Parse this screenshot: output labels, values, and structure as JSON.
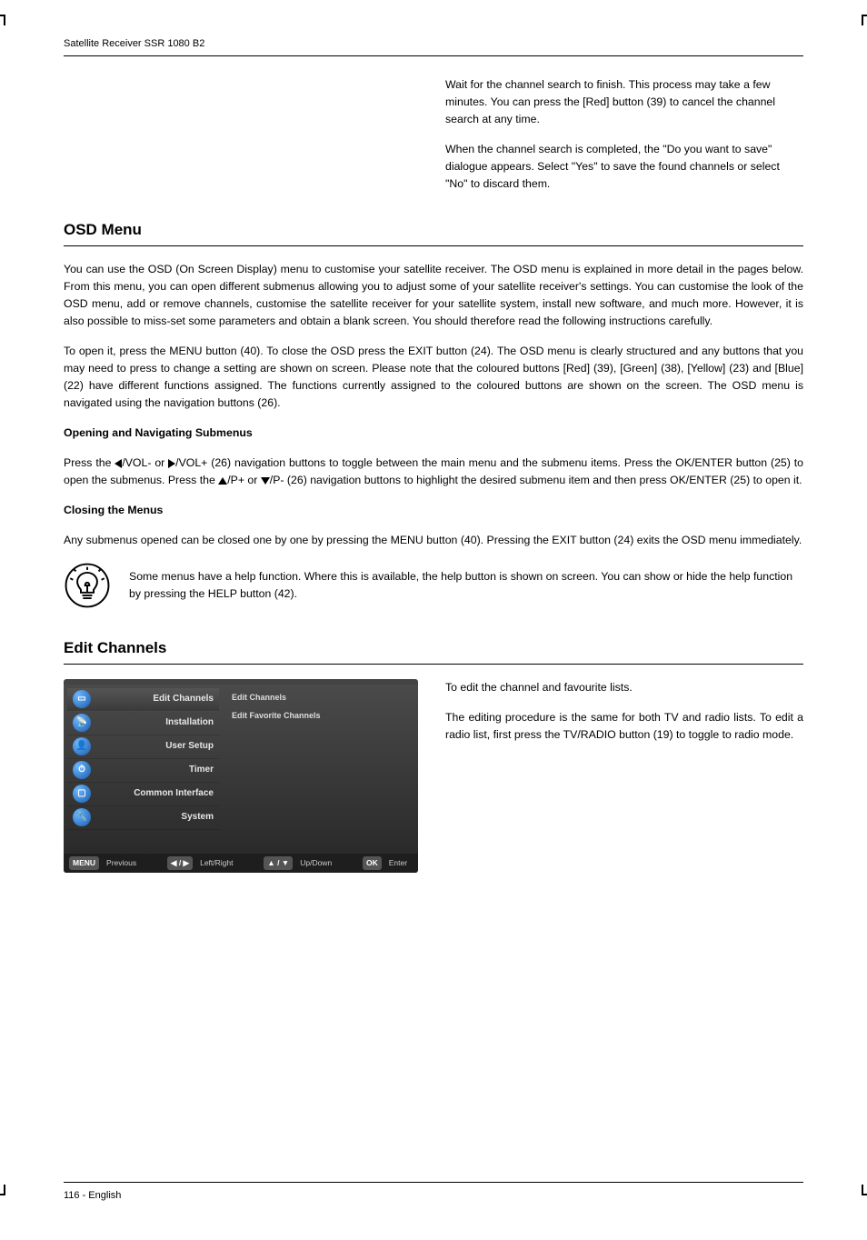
{
  "header": {
    "product": "Satellite Receiver SSR 1080 B2"
  },
  "intro_right": {
    "p1": "Wait for the channel search to finish. This process may take a few minutes. You can press the [Red] button (39) to cancel the channel search at any time.",
    "p2": "When the channel search is completed, the \"Do you want to save\" dialogue appears. Select \"Yes\" to save the found channels or select \"No\" to discard them."
  },
  "osd_menu": {
    "title": "OSD Menu",
    "p1": "You can use the OSD (On Screen Display) menu to customise your satellite receiver. The OSD menu is explained in more detail in the pages below. From this menu, you can open different submenus allowing you to adjust some of your satellite receiver's settings. You can customise the look of the OSD menu, add or remove channels, customise the satellite receiver for your satellite system, install new software, and much more. However, it is also possible to miss-set some parameters and obtain a blank screen. You should therefore read the following instructions carefully.",
    "p2": "To open it, press the MENU button (40). To close the OSD press the EXIT button (24). The OSD menu is clearly structured and any buttons that you may need to press to change a setting are shown on screen. Please note that the coloured buttons [Red] (39), [Green] (38), [Yellow] (23) and [Blue] (22) have different functions assigned. The functions currently assigned to the coloured buttons are shown on the screen. The OSD menu is navigated using the navigation buttons (26).",
    "opening_h": "Opening and Navigating Submenus",
    "opening_p_pre": "Press the ",
    "opening_p_mid1": "/VOL- or ",
    "opening_p_mid2": "/VOL+ (26) navigation buttons to toggle between the main menu and the submenu items. Press the OK/ENTER button (25) to open the submenus. Press the ",
    "opening_p_mid3": "/P+ or ",
    "opening_p_post": "/P- (26) navigation buttons to highlight the desired submenu item and then press OK/ENTER (25) to open it.",
    "closing_h": "Closing the Menus",
    "closing_p": "Any submenus opened can be closed one by one by pressing the MENU button (40). Pressing the EXIT button (24) exits the OSD menu immediately.",
    "note": "Some menus have a help function. Where this is available, the help button is shown on screen. You can show or hide the help function by pressing the HELP button (42)."
  },
  "edit_channels": {
    "title": "Edit Channels",
    "p1": "To edit the channel and favourite lists.",
    "p2": "The editing procedure is the same for both TV and radio lists. To edit a radio list, first press the TV/RADIO button (19) to toggle to radio mode."
  },
  "osd_ui": {
    "left_menu": [
      "Edit Channels",
      "Installation",
      "User Setup",
      "Timer",
      "Common Interface",
      "System"
    ],
    "right_sub": [
      "Edit Channels",
      "Edit Favorite Channels"
    ],
    "footer": {
      "menu_key": "MENU",
      "menu_label": "Previous",
      "lr_key": "◀ / ▶",
      "lr_label": "Left/Right",
      "ud_key": "▲ / ▼",
      "ud_label": "Up/Down",
      "ok_key": "OK",
      "ok_label": "Enter"
    }
  },
  "footer": {
    "page": "116 - English"
  }
}
